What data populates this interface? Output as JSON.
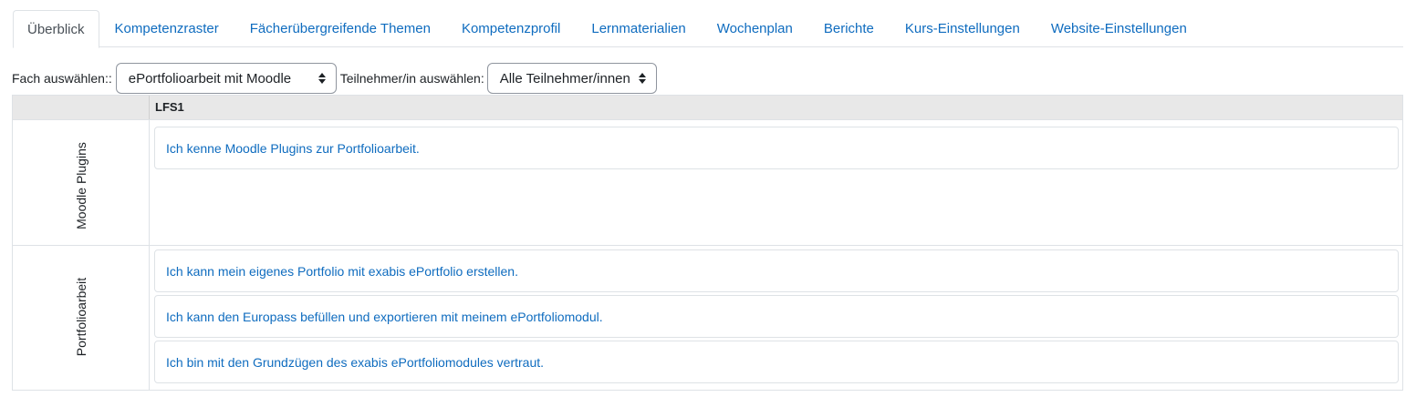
{
  "tabs": [
    {
      "label": "Überblick",
      "active": true
    },
    {
      "label": "Kompetenzraster"
    },
    {
      "label": "Fächerübergreifende Themen"
    },
    {
      "label": "Kompetenzprofil"
    },
    {
      "label": "Lernmaterialien"
    },
    {
      "label": "Wochenplan"
    },
    {
      "label": "Berichte"
    },
    {
      "label": "Kurs-Einstellungen"
    },
    {
      "label": "Website-Einstellungen"
    }
  ],
  "filters": {
    "subject_label": "Fach auswählen::",
    "subject_value": "ePortfolioarbeit mit Moodle",
    "participant_label": "Teilnehmer/in auswählen:",
    "participant_value": "Alle Teilnehmer/innen"
  },
  "grid": {
    "column_header": "LFS1",
    "rows": [
      {
        "label": "Moodle Plugins",
        "items": [
          "Ich kenne Moodle Plugins zur Portfolioarbeit."
        ]
      },
      {
        "label": "Portfolioarbeit",
        "items": [
          "Ich kann mein eigenes Portfolio mit exabis ePortfolio erstellen.",
          "Ich kann den Europass befüllen und exportieren mit meinem ePortfoliomodul.",
          "Ich bin mit den Grundzügen des exabis ePortfoliomodules vertraut."
        ]
      }
    ]
  },
  "colors": {
    "link": "#0f6cbf",
    "border": "#dee2e6",
    "header_bg": "#e8e8e8"
  }
}
